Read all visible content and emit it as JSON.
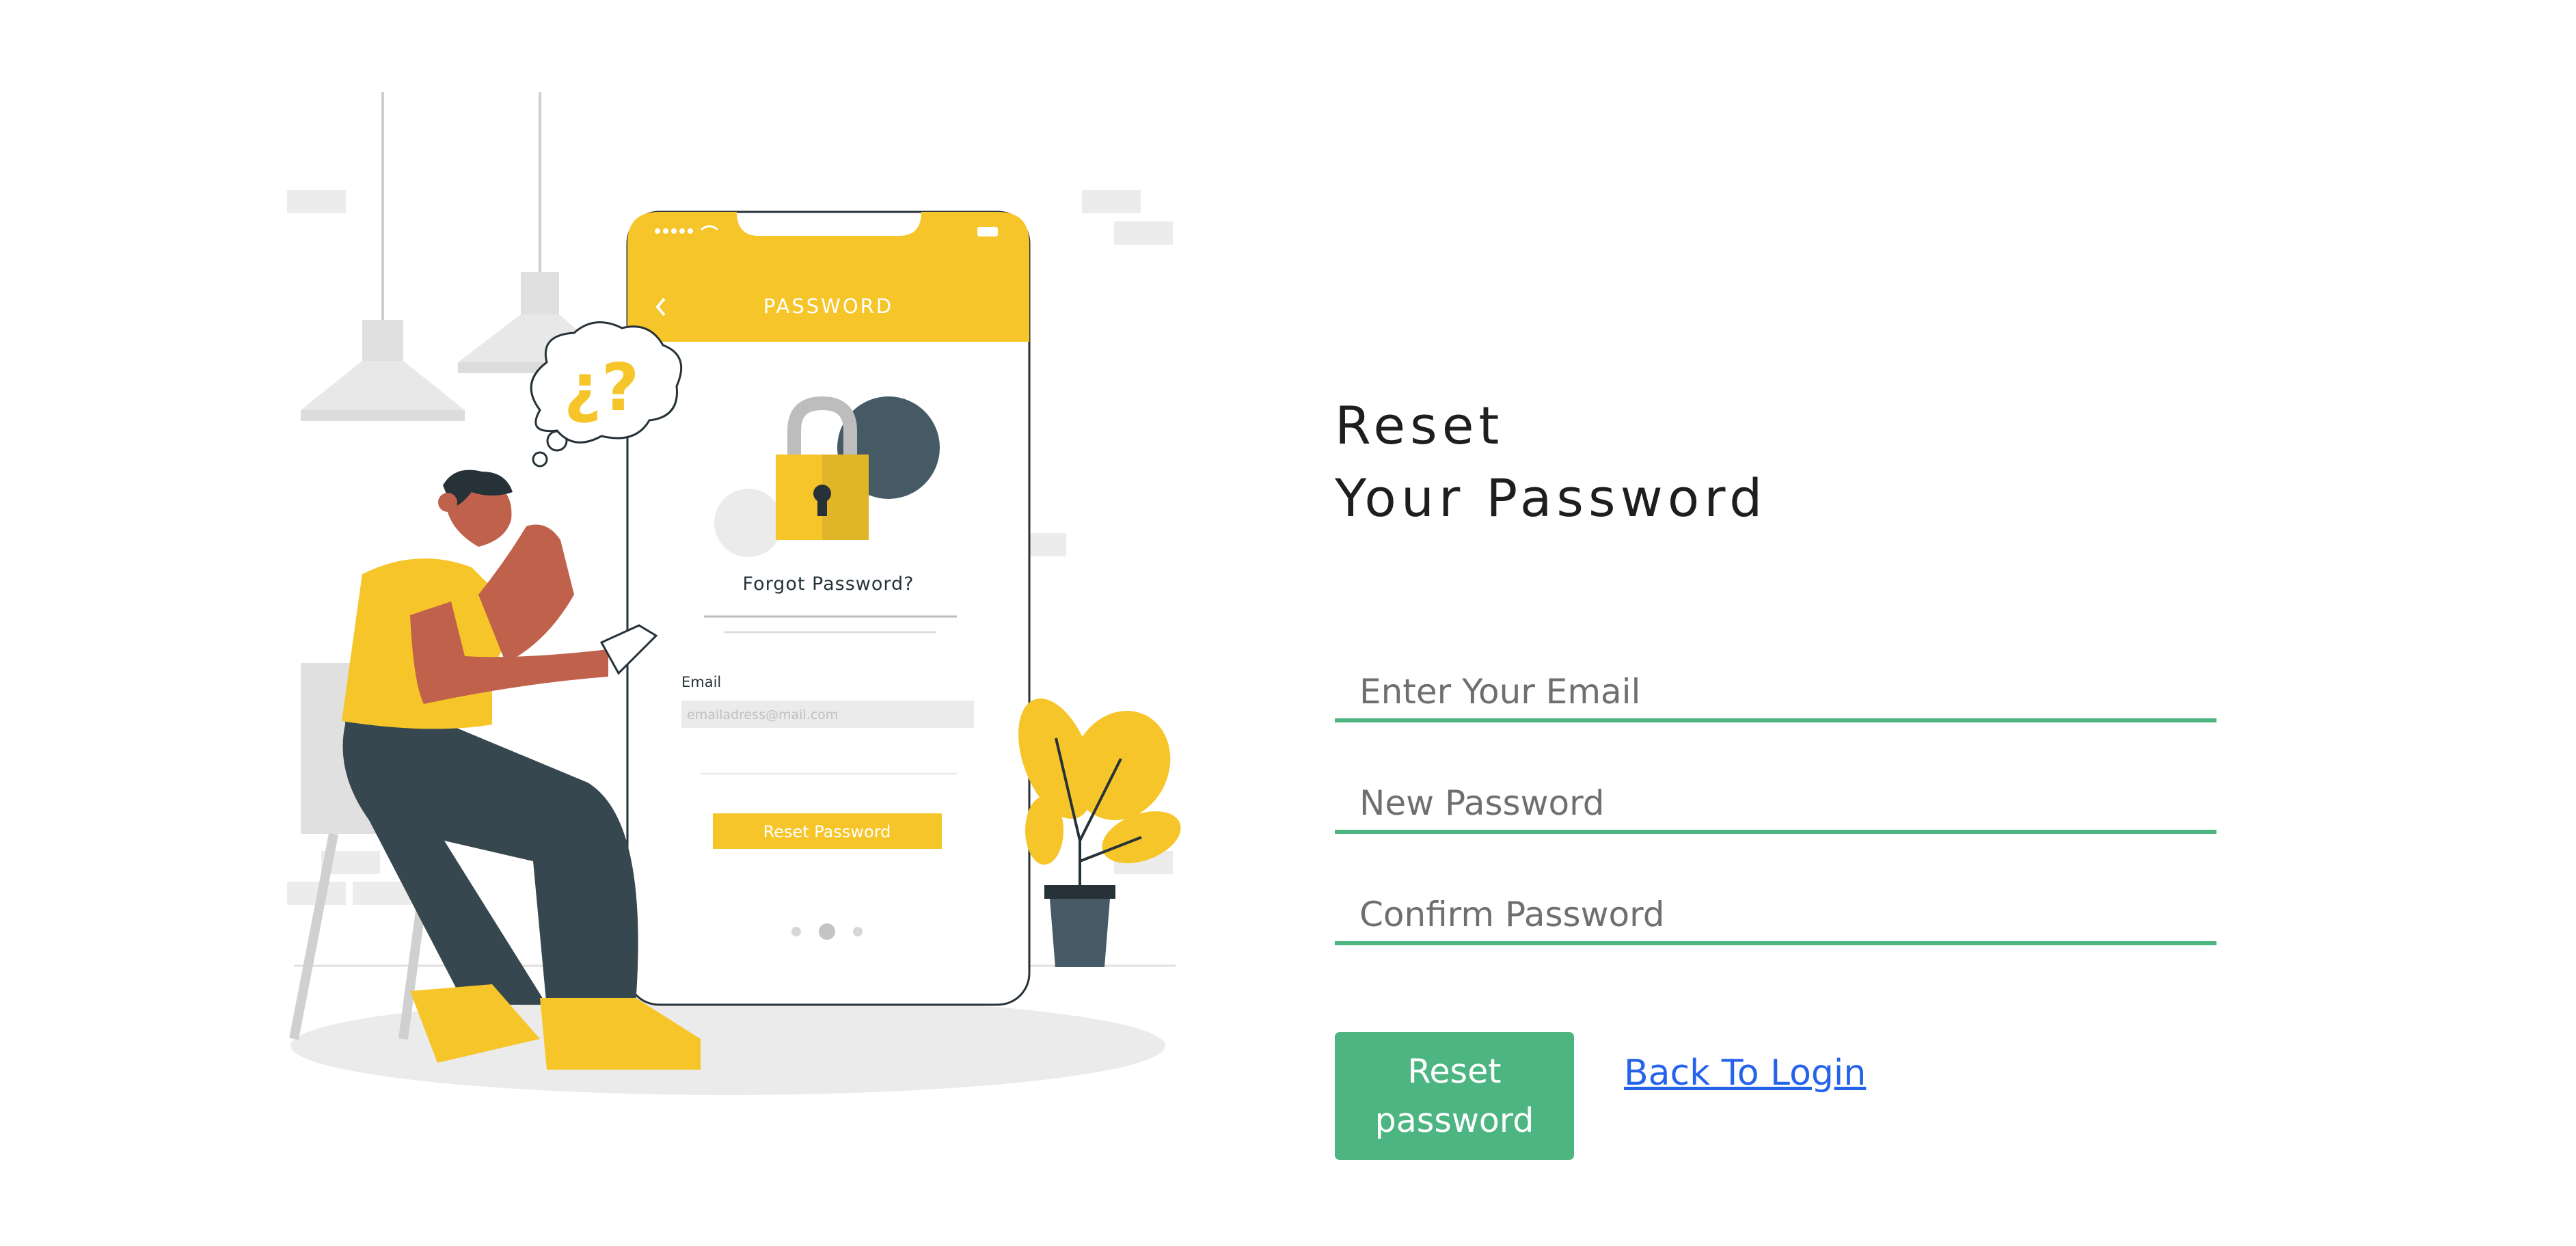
{
  "form": {
    "heading_line1": "Reset",
    "heading_line2": "Your Password",
    "email_placeholder": "Enter Your Email",
    "new_password_placeholder": "New Password",
    "confirm_password_placeholder": "Confirm Password",
    "reset_button_label": "Reset password",
    "back_link_label": "Back To Login"
  },
  "illustration": {
    "question_bubble": "¿?",
    "phone_header_title": "PASSWORD",
    "forgot_title": "Forgot Password?",
    "email_label": "Email",
    "email_placeholder": "emailadress@mail.com",
    "reset_button_label": "Reset Password"
  },
  "colors": {
    "accent_green": "#4cb582",
    "illustration_yellow": "#f6c52a",
    "link_blue": "#2563eb",
    "dark_slate": "#37474f"
  }
}
